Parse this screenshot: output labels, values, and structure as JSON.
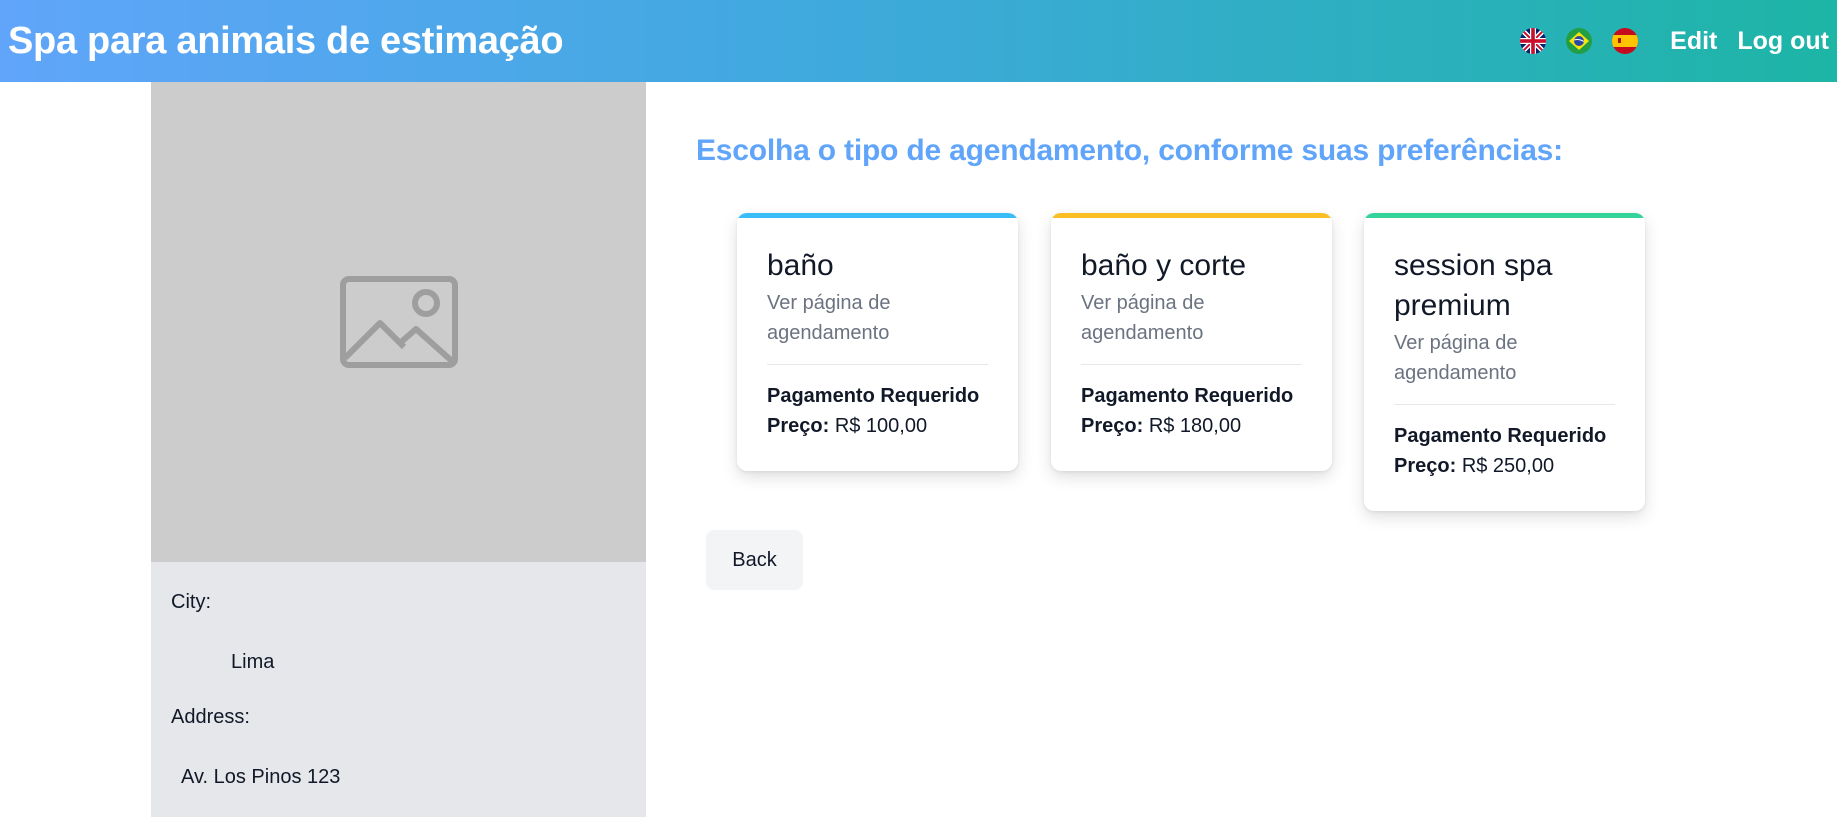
{
  "header": {
    "title": "Spa para animais de estimação",
    "languages": [
      {
        "icon": "uk-flag-icon"
      },
      {
        "icon": "brazil-flag-icon"
      },
      {
        "icon": "spain-flag-icon"
      }
    ],
    "edit_label": "Edit",
    "logout_label": "Log out",
    "gradient_colors": [
      "#60a5fa",
      "#1db5a6"
    ]
  },
  "sidebar": {
    "image_icon": "image-placeholder-icon",
    "city_label": "City:",
    "city_value": "Lima",
    "address_label": "Address:",
    "address_value": "Av. Los Pinos 123"
  },
  "main": {
    "heading": "Escolha o tipo de agendamento, conforme suas preferências:",
    "heading_color": "#60a5fa",
    "cards": [
      {
        "title": "baño",
        "subtitle": "Ver página de agendamento",
        "payment": "Pagamento Requerido",
        "price_label": "Preço:",
        "price_value": "R$ 100,00",
        "accent": "#38bdf8"
      },
      {
        "title": "baño y corte",
        "subtitle": "Ver página de agendamento",
        "payment": "Pagamento Requerido",
        "price_label": "Preço:",
        "price_value": "R$ 180,00",
        "accent": "#fbbf24"
      },
      {
        "title": "session spa premium",
        "subtitle": "Ver página de agendamento",
        "payment": "Pagamento Requerido",
        "price_label": "Preço:",
        "price_value": "R$ 250,00",
        "accent": "#34d399"
      }
    ],
    "back_label": "Back"
  }
}
